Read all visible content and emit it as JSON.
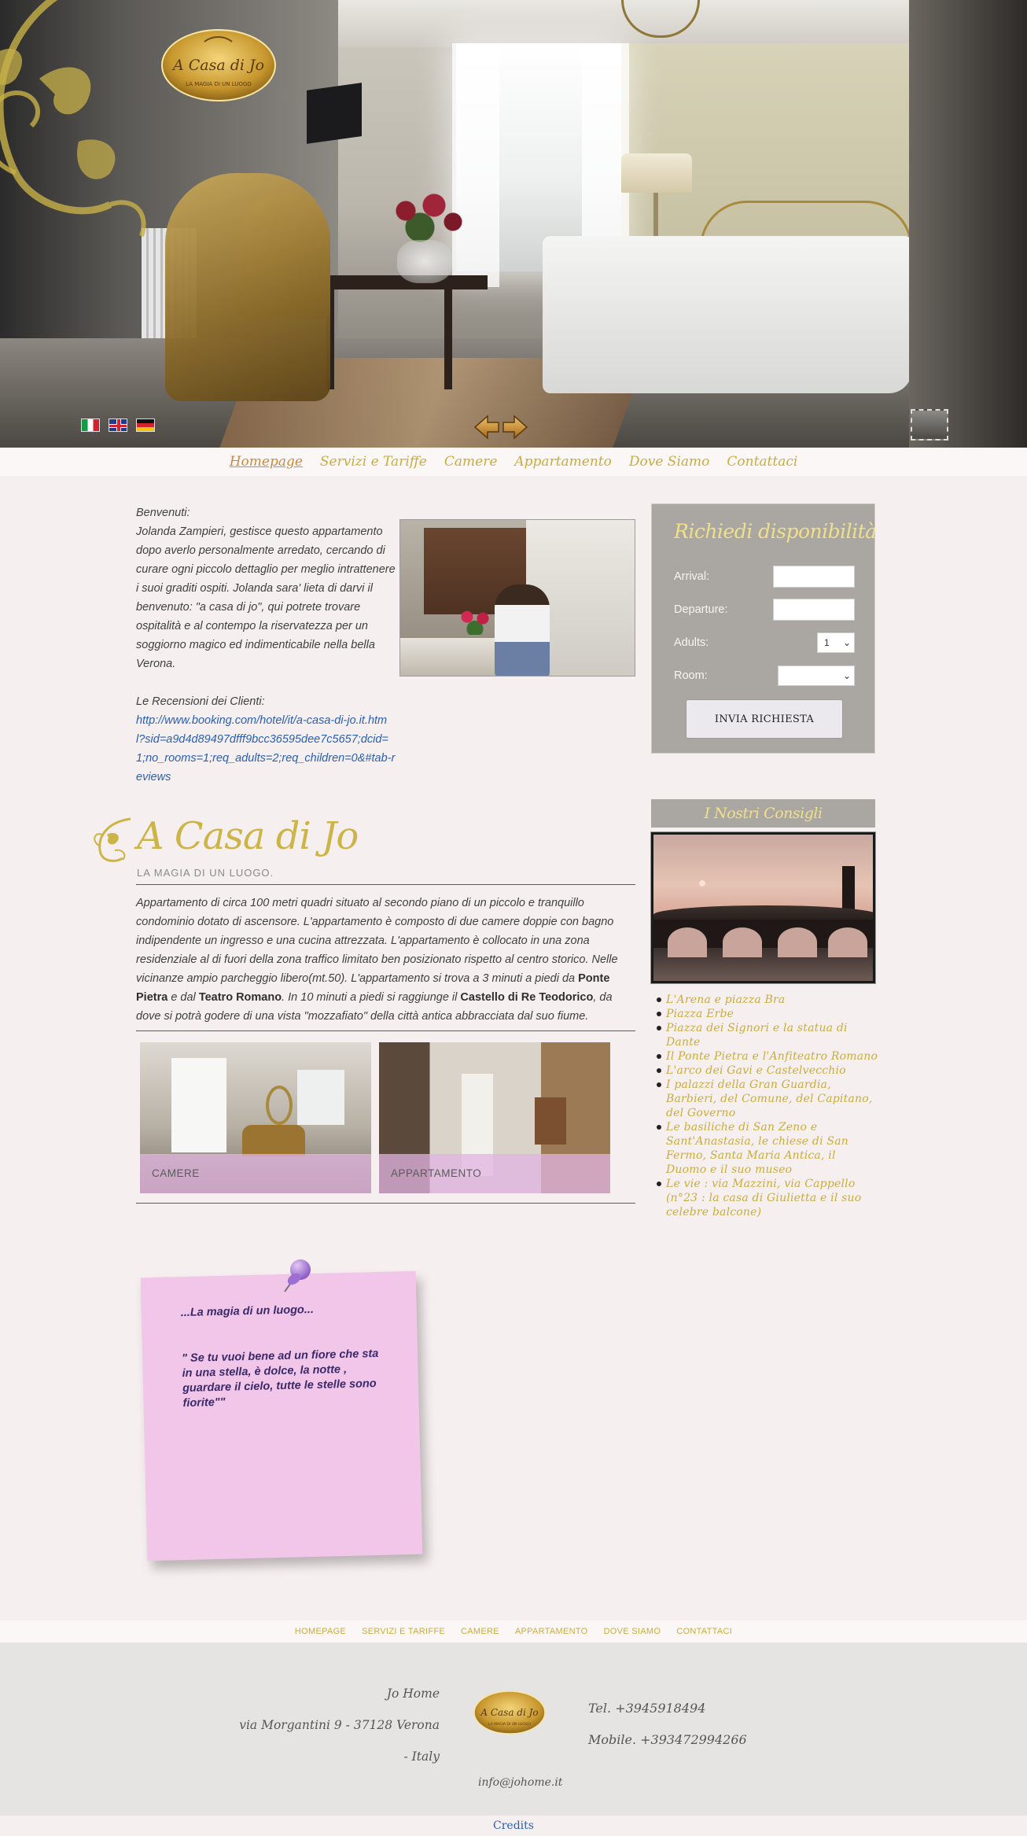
{
  "brand": {
    "logo_line1": "A Casa di Jo",
    "logo_line2": "LA MAGIA DI UN LUOGO"
  },
  "languages": [
    "Italiano",
    "English",
    "Deutsch"
  ],
  "nav": [
    {
      "label": "Homepage",
      "active": true
    },
    {
      "label": "Servizi e Tariffe"
    },
    {
      "label": "Camere"
    },
    {
      "label": "Appartamento"
    },
    {
      "label": "Dove Siamo"
    },
    {
      "label": "Contattaci"
    }
  ],
  "intro": {
    "lines": [
      "Benvenuti:",
      "Jolanda Zampieri, gestisce  questo appartamento dopo averlo personalmente arredato, cercando di curare ogni piccolo dettaglio per meglio intrattenere i suoi graditi ospiti. Jolanda sara' lieta di darvi il benvenuto: \"a casa di jo\", qui potrete trovare ospitalità  e al contempo la riservatezza per un soggiorno magico ed indimenticabile nella bella Verona."
    ],
    "reviews_label": "Le Recensioni dei Clienti:",
    "reviews_link": "http://www.booking.com/hotel/it/a-casa-di-jo.it.html?sid=a9d4d89497dfff9bcc36595dee7c5657;dcid=1;no_rooms=1;req_adults=2;req_children=0&#tab-reviews"
  },
  "section": {
    "title": "A Casa di Jo",
    "subtitle": "LA MAGIA DI UN LUOGO.",
    "p1": "Appartamento di circa 100 metri quadri situato al secondo piano di un piccolo e tranquillo condominio dotato di ascensore. L'appartamento è composto di due camere doppie con bagno indipendente un ingresso e una cucina attrezzata. L'appartamento è collocato in una zona residenziale al di fuori della zona traffico limitato ben posizionato rispetto al centro storico. Nelle vicinanze ampio parcheggio libero(mt.50). L'appartamento si trova a 3 minuti a piedi  da ",
    "b1": "Ponte Pietra",
    "p2": " e dal ",
    "b2": "Teatro Romano",
    "p3": ". In 10 minuti a piedi si raggiunge il ",
    "b3": "Castello di Re Teodorico",
    "p4": ", da dove si potrà godere di una vista \"mozzafiato\" della città antica abbracciata dal suo fiume."
  },
  "cards": [
    {
      "label": "CAMERE"
    },
    {
      "label": "APPARTAMENTO"
    }
  ],
  "booking": {
    "title": "Richiedi disponibilità",
    "arrival_label": "Arrival:",
    "departure_label": "Departure:",
    "adults_label": "Adults:",
    "adults_value": "1",
    "room_label": "Room:",
    "room_value": "",
    "submit_label": "INVIA RICHIESTA"
  },
  "consigli": {
    "title": "I Nostri Consigli",
    "items": [
      "L'Arena e piazza Bra",
      "Piazza Erbe",
      "Piazza dei Signori e la statua di Dante",
      "Il Ponte Pietra e l'Anfiteatro Romano",
      "L'arco dei Gavi e Castelvecchio",
      "I palazzi della Gran Guardia, Barbieri, del Comune, del Capitano, del Governo",
      "Le basiliche di San Zeno e Sant'Anastasia, le chiese di San Fermo, Santa Maria Antica, il Duomo e il suo museo",
      "Le vie : via Mazzini, via Cappello (n°23 : la casa di Giulietta e il suo celebre balcone)"
    ]
  },
  "postit": {
    "line1": "...La magia di un luogo...",
    "line2": "\" Se tu vuoi bene ad un fiore che sta in una stella, è dolce, la notte , guardare il cielo, tutte le stelle sono fiorite\"\""
  },
  "footer_nav": [
    "HOMEPAGE",
    "SERVIZI E TARIFFE",
    "CAMERE",
    "APPARTAMENTO",
    "DOVE SIAMO",
    "CONTATTACI"
  ],
  "footer": {
    "name": "Jo Home",
    "address": "via Morgantini 9 - 37128 Verona",
    "country": "- Italy",
    "tel": "Tel. +3945918494",
    "mobile": "Mobile. +393472994266",
    "email": "info@johome.it",
    "credits": "Credits"
  },
  "colors": {
    "gold": "#c9ad3c",
    "sidebar_gray": "#aaa6a2",
    "postit_pink": "#f2c6e8",
    "link_blue": "#2a5fb0"
  }
}
